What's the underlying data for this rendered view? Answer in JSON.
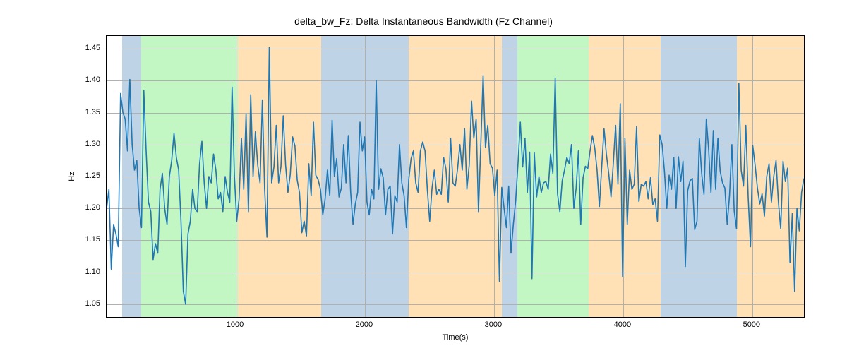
{
  "chart_data": {
    "type": "line",
    "title": "delta_bw_Fz: Delta Instantaneous Bandwidth (Fz Channel)",
    "xlabel": "Time(s)",
    "ylabel": "Hz",
    "xlim": [
      0,
      5400
    ],
    "ylim": [
      1.03,
      1.47
    ],
    "xticks": [
      1000,
      2000,
      3000,
      4000,
      5000
    ],
    "yticks": [
      1.05,
      1.1,
      1.15,
      1.2,
      1.25,
      1.3,
      1.35,
      1.4,
      1.45
    ],
    "bands": [
      {
        "start": 120,
        "end": 270,
        "color": "blue"
      },
      {
        "start": 270,
        "end": 1015,
        "color": "green"
      },
      {
        "start": 1015,
        "end": 1660,
        "color": "orange"
      },
      {
        "start": 1660,
        "end": 2340,
        "color": "blue"
      },
      {
        "start": 2340,
        "end": 3060,
        "color": "orange"
      },
      {
        "start": 3060,
        "end": 3180,
        "color": "blue"
      },
      {
        "start": 3180,
        "end": 3735,
        "color": "green"
      },
      {
        "start": 3735,
        "end": 4290,
        "color": "orange"
      },
      {
        "start": 4290,
        "end": 4880,
        "color": "blue"
      },
      {
        "start": 4880,
        "end": 5400,
        "color": "orange"
      }
    ],
    "x": [
      0,
      18,
      36,
      54,
      72,
      90,
      108,
      126,
      144,
      162,
      180,
      198,
      216,
      234,
      252,
      270,
      288,
      306,
      324,
      342,
      360,
      378,
      396,
      414,
      432,
      450,
      468,
      486,
      504,
      522,
      540,
      558,
      576,
      594,
      612,
      630,
      648,
      666,
      684,
      702,
      720,
      738,
      756,
      774,
      792,
      810,
      828,
      846,
      864,
      882,
      900,
      918,
      936,
      954,
      972,
      990,
      1008,
      1026,
      1044,
      1062,
      1080,
      1098,
      1116,
      1134,
      1152,
      1170,
      1188,
      1206,
      1224,
      1242,
      1260,
      1278,
      1296,
      1314,
      1332,
      1350,
      1368,
      1386,
      1404,
      1422,
      1440,
      1458,
      1476,
      1494,
      1512,
      1530,
      1548,
      1566,
      1584,
      1602,
      1620,
      1638,
      1656,
      1674,
      1692,
      1710,
      1728,
      1746,
      1764,
      1782,
      1800,
      1818,
      1836,
      1854,
      1872,
      1890,
      1908,
      1926,
      1944,
      1962,
      1980,
      1998,
      2016,
      2034,
      2052,
      2070,
      2088,
      2106,
      2124,
      2142,
      2160,
      2178,
      2196,
      2214,
      2232,
      2250,
      2268,
      2286,
      2304,
      2322,
      2340,
      2358,
      2376,
      2394,
      2412,
      2430,
      2448,
      2466,
      2484,
      2502,
      2520,
      2538,
      2556,
      2574,
      2592,
      2610,
      2628,
      2646,
      2664,
      2682,
      2700,
      2718,
      2736,
      2754,
      2772,
      2790,
      2808,
      2826,
      2844,
      2862,
      2880,
      2898,
      2916,
      2934,
      2952,
      2970,
      2988,
      3006,
      3024,
      3042,
      3060,
      3078,
      3096,
      3114,
      3132,
      3150,
      3168,
      3186,
      3204,
      3222,
      3240,
      3258,
      3276,
      3294,
      3312,
      3330,
      3348,
      3366,
      3384,
      3402,
      3420,
      3438,
      3456,
      3474,
      3492,
      3510,
      3528,
      3546,
      3564,
      3582,
      3600,
      3618,
      3636,
      3654,
      3672,
      3690,
      3708,
      3726,
      3744,
      3762,
      3780,
      3798,
      3816,
      3834,
      3852,
      3870,
      3888,
      3906,
      3924,
      3942,
      3960,
      3978,
      3996,
      4014,
      4032,
      4050,
      4068,
      4086,
      4104,
      4122,
      4140,
      4158,
      4176,
      4194,
      4212,
      4230,
      4248,
      4266,
      4284,
      4302,
      4320,
      4338,
      4356,
      4374,
      4392,
      4410,
      4428,
      4446,
      4464,
      4482,
      4500,
      4518,
      4536,
      4554,
      4572,
      4590,
      4608,
      4626,
      4644,
      4662,
      4680,
      4698,
      4716,
      4734,
      4752,
      4770,
      4788,
      4806,
      4824,
      4842,
      4860,
      4878,
      4896,
      4914,
      4932,
      4950,
      4968,
      4986,
      5004,
      5022,
      5040,
      5058,
      5076,
      5094,
      5112,
      5130,
      5148,
      5166,
      5184,
      5202,
      5220,
      5238,
      5256,
      5274,
      5292,
      5310,
      5328,
      5346,
      5364,
      5382,
      5400
    ],
    "values": [
      1.2,
      1.23,
      1.105,
      1.175,
      1.16,
      1.14,
      1.38,
      1.35,
      1.34,
      1.29,
      1.402,
      1.3,
      1.26,
      1.275,
      1.2,
      1.17,
      1.385,
      1.29,
      1.21,
      1.195,
      1.12,
      1.145,
      1.13,
      1.23,
      1.255,
      1.2,
      1.175,
      1.25,
      1.275,
      1.318,
      1.28,
      1.26,
      1.18,
      1.07,
      1.05,
      1.16,
      1.18,
      1.23,
      1.2,
      1.195,
      1.27,
      1.305,
      1.24,
      1.2,
      1.25,
      1.24,
      1.285,
      1.26,
      1.215,
      1.225,
      1.195,
      1.25,
      1.225,
      1.21,
      1.39,
      1.25,
      1.18,
      1.215,
      1.31,
      1.23,
      1.348,
      1.195,
      1.378,
      1.25,
      1.32,
      1.268,
      1.24,
      1.37,
      1.23,
      1.155,
      1.452,
      1.24,
      1.265,
      1.33,
      1.24,
      1.265,
      1.345,
      1.268,
      1.225,
      1.253,
      1.312,
      1.298,
      1.244,
      1.225,
      1.162,
      1.18,
      1.157,
      1.27,
      1.22,
      1.335,
      1.252,
      1.245,
      1.23,
      1.19,
      1.215,
      1.26,
      1.22,
      1.338,
      1.25,
      1.278,
      1.218,
      1.232,
      1.3,
      1.24,
      1.314,
      1.225,
      1.175,
      1.207,
      1.225,
      1.335,
      1.29,
      1.312,
      1.21,
      1.19,
      1.23,
      1.215,
      1.4,
      1.23,
      1.262,
      1.248,
      1.19,
      1.23,
      1.235,
      1.16,
      1.22,
      1.21,
      1.3,
      1.24,
      1.22,
      1.17,
      1.245,
      1.278,
      1.29,
      1.24,
      1.225,
      1.29,
      1.304,
      1.29,
      1.229,
      1.18,
      1.232,
      1.26,
      1.222,
      1.23,
      1.222,
      1.28,
      1.262,
      1.21,
      1.31,
      1.24,
      1.235,
      1.262,
      1.3,
      1.26,
      1.325,
      1.23,
      1.268,
      1.368,
      1.31,
      1.34,
      1.195,
      1.3,
      1.408,
      1.295,
      1.33,
      1.27,
      1.263,
      1.22,
      1.26,
      1.086,
      1.233,
      1.2,
      1.17,
      1.235,
      1.13,
      1.175,
      1.212,
      1.27,
      1.335,
      1.265,
      1.31,
      1.225,
      1.288,
      1.09,
      1.287,
      1.218,
      1.25,
      1.225,
      1.24,
      1.242,
      1.23,
      1.285,
      1.255,
      1.404,
      1.223,
      1.195,
      1.243,
      1.26,
      1.28,
      1.27,
      1.3,
      1.2,
      1.232,
      1.29,
      1.175,
      1.248,
      1.266,
      1.262,
      1.29,
      1.314,
      1.295,
      1.26,
      1.203,
      1.265,
      1.325,
      1.285,
      1.255,
      1.218,
      1.27,
      1.33,
      1.238,
      1.364,
      1.093,
      1.31,
      1.175,
      1.26,
      1.23,
      1.238,
      1.328,
      1.211,
      1.238,
      1.235,
      1.242,
      1.215,
      1.248,
      1.206,
      1.215,
      1.18,
      1.315,
      1.3,
      1.258,
      1.2,
      1.252,
      1.23,
      1.28,
      1.2,
      1.281,
      1.242,
      1.274,
      1.109,
      1.228,
      1.243,
      1.247,
      1.167,
      1.18,
      1.31,
      1.255,
      1.222,
      1.34,
      1.292,
      1.225,
      1.322,
      1.23,
      1.31,
      1.258,
      1.24,
      1.232,
      1.175,
      1.221,
      1.3,
      1.196,
      1.168,
      1.396,
      1.26,
      1.235,
      1.33,
      1.218,
      1.14,
      1.298,
      1.268,
      1.232,
      1.207,
      1.223,
      1.188,
      1.25,
      1.27,
      1.21,
      1.25,
      1.275,
      1.21,
      1.168,
      1.274,
      1.242,
      1.263,
      1.115,
      1.192,
      1.07,
      1.2,
      1.165,
      1.225,
      1.247
    ]
  }
}
